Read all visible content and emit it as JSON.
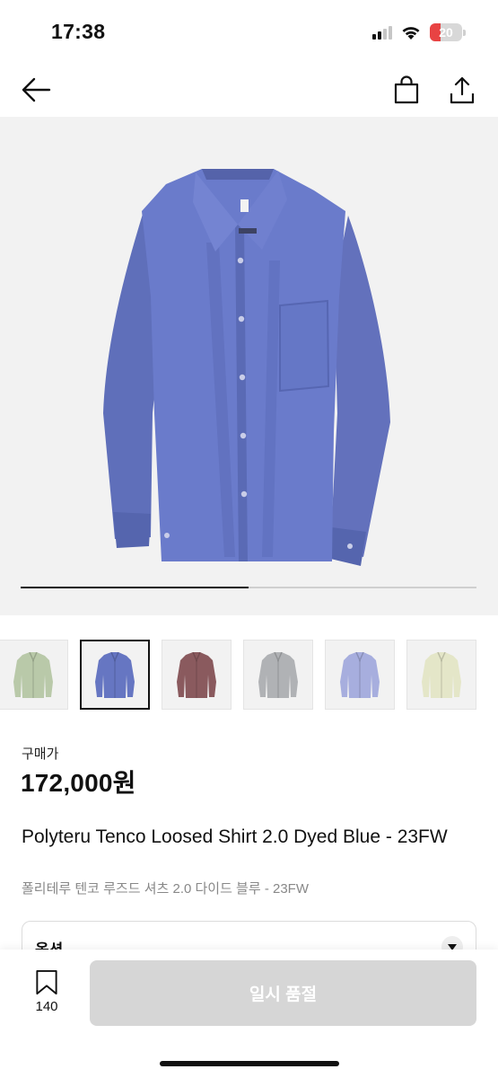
{
  "status_bar": {
    "time": "17:38",
    "battery": "20",
    "battery_color": "#e84343"
  },
  "header": {
    "back_icon": "arrow-left-icon",
    "bag_icon": "shopping-bag-icon",
    "share_icon": "share-icon"
  },
  "gallery": {
    "progress": 0.5,
    "selected_index": 1,
    "main_color": "#6878c8"
  },
  "thumbnails": [
    {
      "color": "#b9c9a9",
      "name": "sage"
    },
    {
      "color": "#6676c2",
      "name": "dyed-blue"
    },
    {
      "color": "#8a5a5e",
      "name": "burgundy"
    },
    {
      "color": "#b0b2b5",
      "name": "grey"
    },
    {
      "color": "#a7aede",
      "name": "lavender"
    },
    {
      "color": "#e4e6c8",
      "name": "cream"
    }
  ],
  "product": {
    "price_label": "구매가",
    "price": "172,000원",
    "title_en": "Polyteru Tenco Loosed Shirt 2.0 Dyed Blue - 23FW",
    "title_ko": "폴리테루 텐코 루즈드 셔츠 2.0 다이드 블루 - 23FW"
  },
  "options": {
    "label": "옵션",
    "chevron_icon": "chevron-down-icon"
  },
  "bottom": {
    "wish_count": "140",
    "cta_label": "일시 품절",
    "cta_color": "#d6d6d6"
  }
}
